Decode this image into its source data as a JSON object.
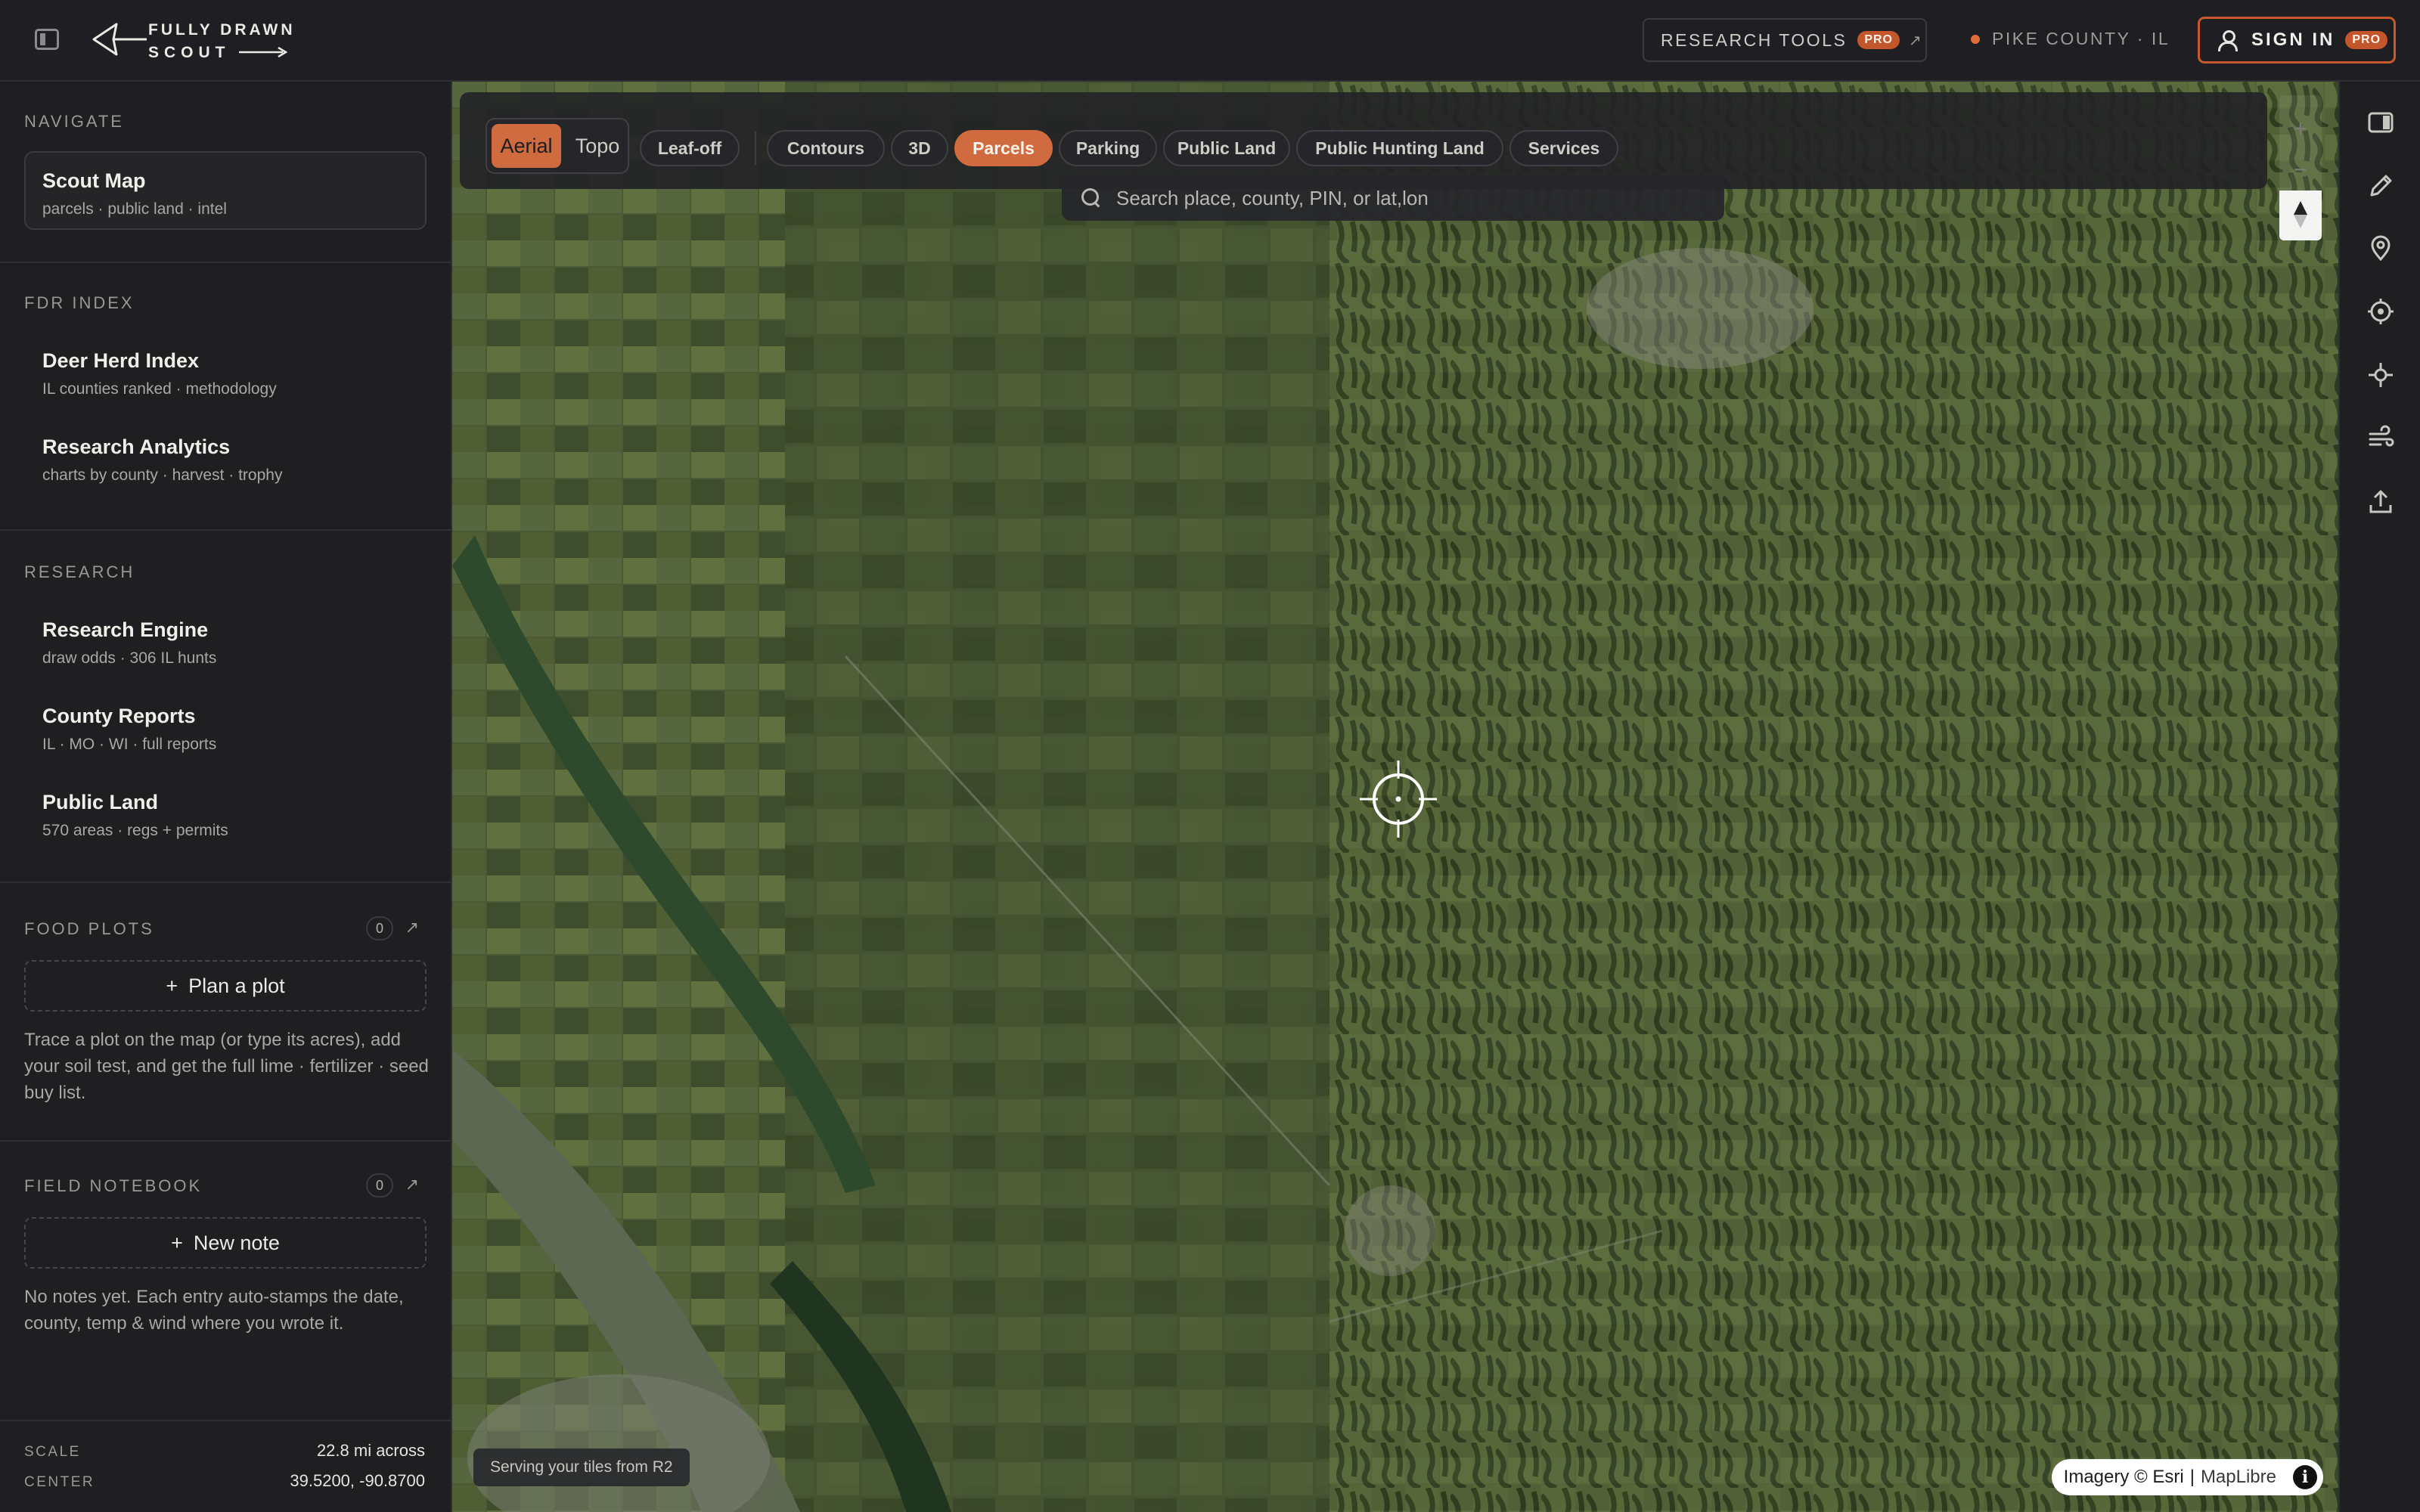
{
  "brand": {
    "line1": "FULLY DRAWN",
    "line2": "SCOUT"
  },
  "header": {
    "research_tools": "RESEARCH TOOLS",
    "research_badge": "PRO",
    "research_arrow": "↗",
    "location": "PIKE COUNTY · IL",
    "sign_in": "SIGN IN",
    "sign_in_badge": "PRO"
  },
  "sidebar": {
    "navigate": {
      "title": "NAVIGATE",
      "items": [
        {
          "label": "Scout Map",
          "sub": "parcels · public land · intel"
        }
      ]
    },
    "fdr_index": {
      "title": "FDR INDEX",
      "items": [
        {
          "label": "Deer Herd Index",
          "sub": "IL counties ranked · methodology"
        },
        {
          "label": "Research Analytics",
          "sub": "charts by county · harvest · trophy"
        }
      ]
    },
    "research": {
      "title": "RESEARCH",
      "items": [
        {
          "label": "Research Engine",
          "sub": "draw odds · 306 IL hunts"
        },
        {
          "label": "County Reports",
          "sub": "IL · MO · WI · full reports"
        },
        {
          "label": "Public Land",
          "sub": "570 areas · regs + permits"
        }
      ]
    },
    "food_plots": {
      "title": "FOOD PLOTS",
      "count": "0",
      "arrow": "↗",
      "button": "Plan a plot",
      "plus": "+",
      "text": "Trace a plot on the map (or type its acres), add your soil test, and get the full lime · fertilizer · seed buy list."
    },
    "field_notebook": {
      "title": "FIELD NOTEBOOK",
      "count": "0",
      "arrow": "↗",
      "button": "New note",
      "plus": "+",
      "text": "No notes yet. Each entry auto-stamps the date, county, temp & wind where you wrote it."
    },
    "stats": {
      "scale_label": "SCALE",
      "scale_value": "22.8 mi across",
      "center_label": "CENTER",
      "center_value": "39.5200, -90.8700"
    }
  },
  "map": {
    "basemap": {
      "options": [
        "Aerial",
        "Topo"
      ],
      "selected": "Aerial"
    },
    "leaf_off": "Leaf-off",
    "layers": [
      {
        "label": "Contours",
        "active": false
      },
      {
        "label": "3D",
        "active": false
      },
      {
        "label": "Parcels",
        "active": true
      },
      {
        "label": "Parking",
        "active": false
      },
      {
        "label": "Public Land",
        "active": false
      },
      {
        "label": "Public Hunting Land",
        "active": false
      },
      {
        "label": "Services",
        "active": false
      }
    ],
    "search_placeholder": "Search place, county, PIN, or lat,lon",
    "zoom_in": "+",
    "zoom_out": "−",
    "tiles_note": "Serving your tiles from R2",
    "attribution": {
      "imagery": "Imagery © Esri",
      "sep": "|",
      "maplibre": "MapLibre",
      "info": "i"
    }
  },
  "colors": {
    "accent": "#d06a3f",
    "accent_border": "#c9592d",
    "bg": "#1f1f22"
  },
  "rail_icons": [
    "panel-toggle-icon",
    "pencil-icon",
    "map-pin-icon",
    "target-icon",
    "crosshair-icon",
    "wind-icon",
    "upload-icon"
  ]
}
